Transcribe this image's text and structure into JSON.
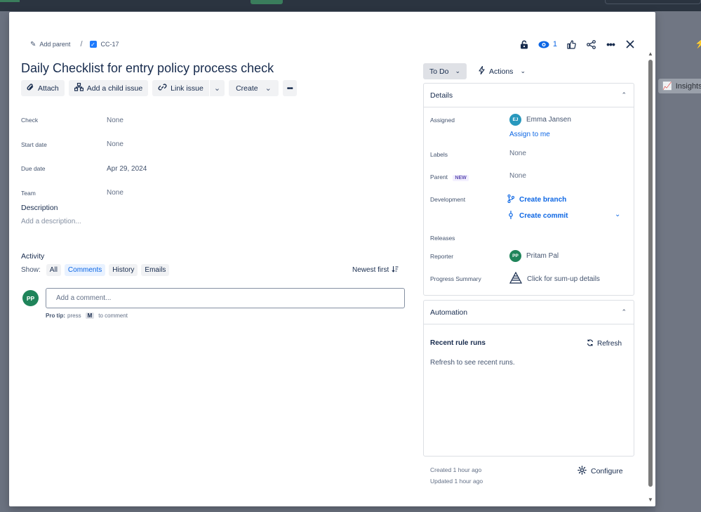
{
  "background": {
    "insights_label": "Insights"
  },
  "breadcrumb": {
    "add_parent": "Add parent",
    "separator": "/",
    "issue_key": "CC-17"
  },
  "header": {
    "watch_count": "1"
  },
  "issue": {
    "title": "Daily Checklist for entry policy process check"
  },
  "toolbar": {
    "attach": "Attach",
    "add_child": "Add a child issue",
    "link_issue": "Link issue",
    "create": "Create",
    "more": "•••"
  },
  "fields": [
    {
      "label": "Check",
      "value": "None"
    },
    {
      "label": "Start date",
      "value": "None"
    },
    {
      "label": "Due date",
      "value": "Apr 29, 2024"
    },
    {
      "label": "Team",
      "value": "None"
    }
  ],
  "description": {
    "heading": "Description",
    "placeholder": "Add a description..."
  },
  "activity": {
    "heading": "Activity",
    "show_label": "Show:",
    "filters": [
      "All",
      "Comments",
      "History",
      "Emails"
    ],
    "sort_label": "Newest first",
    "comment_avatar": "PP",
    "comment_placeholder": "Add a comment...",
    "protip_bold": "Pro tip:",
    "protip_press": "press",
    "protip_key": "M",
    "protip_rest": "to comment"
  },
  "status": {
    "label": "To Do",
    "actions_label": "Actions"
  },
  "details": {
    "heading": "Details",
    "assigned_label": "Assigned",
    "assignee_initials": "EJ",
    "assignee_name": "Emma Jansen",
    "assign_to_me": "Assign to me",
    "labels_label": "Labels",
    "labels_value": "None",
    "parent_label": "Parent",
    "parent_badge": "NEW",
    "parent_value": "None",
    "development_label": "Development",
    "create_branch": "Create branch",
    "create_commit": "Create commit",
    "releases_label": "Releases",
    "reporter_label": "Reporter",
    "reporter_initials": "PP",
    "reporter_name": "Pritam Pal",
    "progress_label": "Progress Summary",
    "progress_value": "Click for sum-up details"
  },
  "automation": {
    "heading": "Automation",
    "subheading": "Recent rule runs",
    "refresh": "Refresh",
    "message": "Refresh to see recent runs."
  },
  "footer": {
    "created": "Created 1 hour ago",
    "updated": "Updated 1 hour ago",
    "configure": "Configure"
  },
  "colors": {
    "link": "#0c66e4",
    "avatar_pp": "#1f845a",
    "avatar_ej": "#2898bd"
  }
}
